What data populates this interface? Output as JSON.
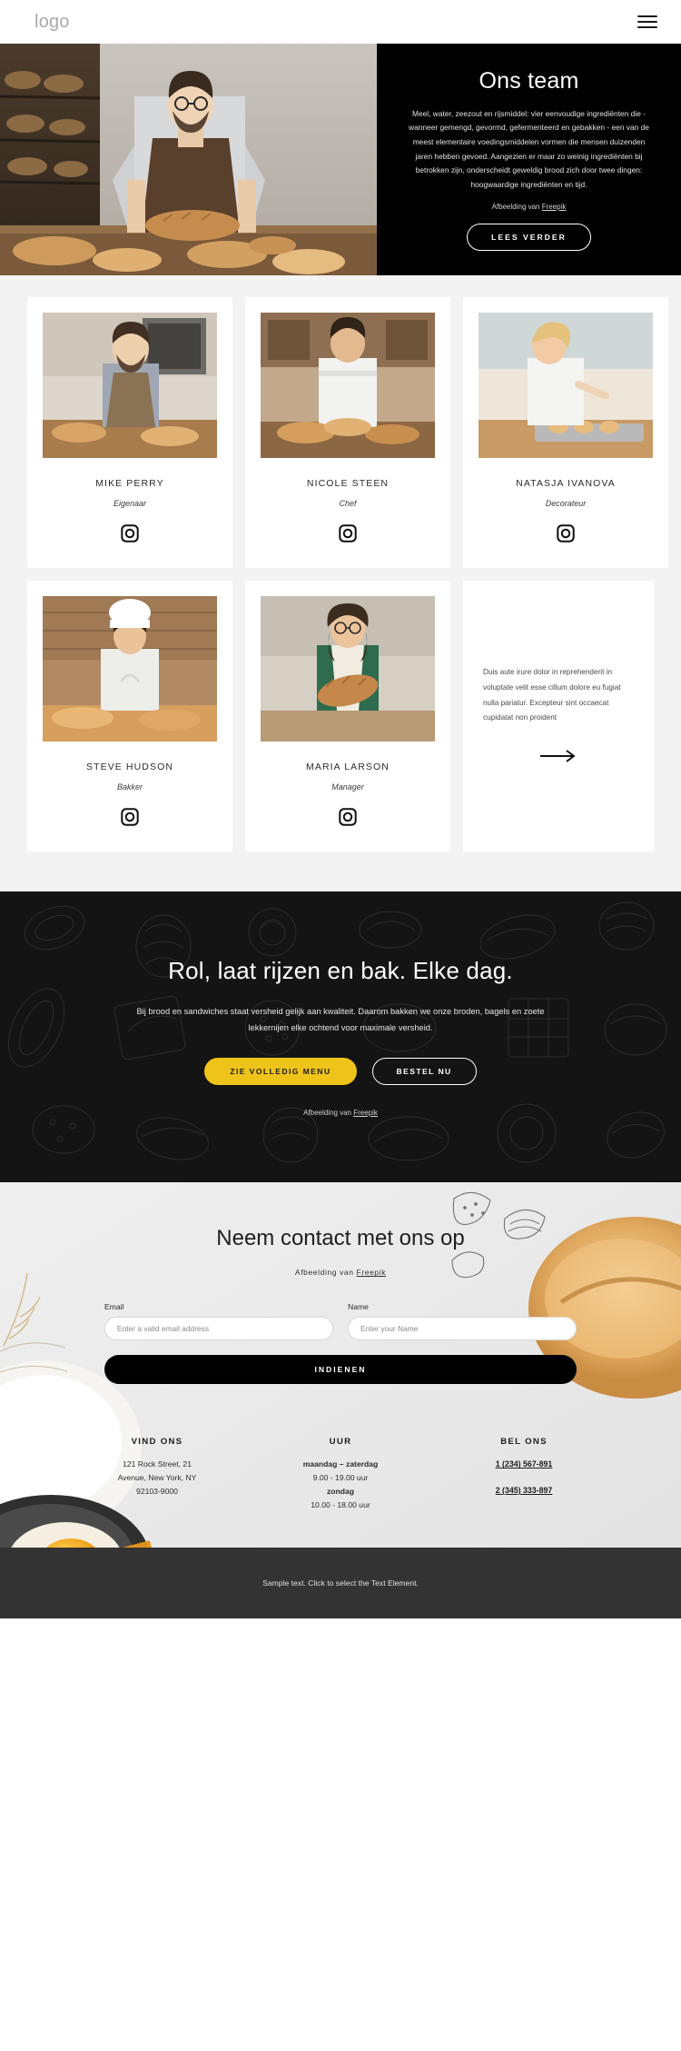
{
  "header": {
    "logo": "logo",
    "menu_icon": "hamburger-icon"
  },
  "hero": {
    "title": "Ons team",
    "paragraph": "Meel, water, zeezout en rijsmiddel: vier eenvoudige ingrediënten die - wanneer gemengd, gevormd, gefermenteerd en gebakken - een van de meest elementaire voedingsmiddelen vormen die mensen duizenden jaren hebben gevoed. Aangezien er maar zo weinig ingrediënten bij betrokken zijn, onderscheidt geweldig brood zich door twee dingen: hoogwaardige ingrediënten en tijd.",
    "credit_prefix": "Afbeelding van ",
    "credit_link": "Freepik",
    "button": "LEES VERDER"
  },
  "team": {
    "members": [
      {
        "name": "MIKE PERRY",
        "role": "Eigenaar",
        "social": "instagram-icon"
      },
      {
        "name": "NICOLE STEEN",
        "role": "Chef",
        "social": "instagram-icon"
      },
      {
        "name": "NATASJA IVANOVA",
        "role": "Decorateur",
        "social": "instagram-icon"
      },
      {
        "name": "STEVE HUDSON",
        "role": "Bakker",
        "social": "instagram-icon"
      },
      {
        "name": "MARIA LARSON",
        "role": "Manager",
        "social": "instagram-icon"
      }
    ],
    "text_card": {
      "body": "Duis aute irure dolor in reprehenderit in voluptate velit esse cillum dolore eu fugiat nulla pariatur. Excepteur sint occaecat cupidatat non proident",
      "arrow": "arrow-right-icon"
    }
  },
  "cta": {
    "title": "Rol, laat rijzen en bak. Elke dag.",
    "subtitle": "Bij brood en sandwiches staat versheid gelijk aan kwaliteit. Daarom bakken we onze broden, bagels en zoete lekkernijen elke ochtend voor maximale versheid.",
    "primary_button": "ZIE VOLLEDIG MENU",
    "secondary_button": "BESTEL NU",
    "credit_prefix": "Afbeelding van ",
    "credit_link": "Freepik",
    "accent_color": "#efc41a"
  },
  "contact": {
    "title": "Neem contact met ons op",
    "credit_prefix": "Afbeelding van ",
    "credit_link": "Freepik",
    "email_label": "Email",
    "email_placeholder": "Enter a valid email address",
    "email_value": "",
    "name_label": "Name",
    "name_placeholder": "Enter your Name",
    "name_value": "",
    "submit_button": "INDIENEN",
    "columns": [
      {
        "heading": "VIND ONS",
        "lines": [
          "121 Rock Street, 21",
          "Avenue, New York, NY",
          "92103-9000"
        ]
      },
      {
        "heading": "UUR",
        "lines": [
          "maandag – zaterdag",
          "9.00 - 19.00 uur",
          "zondag",
          "10.00 - 18.00 uur"
        ]
      },
      {
        "heading": "BEL ONS",
        "phones": [
          "1 (234) 567-891",
          "2 (345) 333-897"
        ]
      }
    ]
  },
  "footer": {
    "text": "Sample text. Click to select the Text Element."
  }
}
